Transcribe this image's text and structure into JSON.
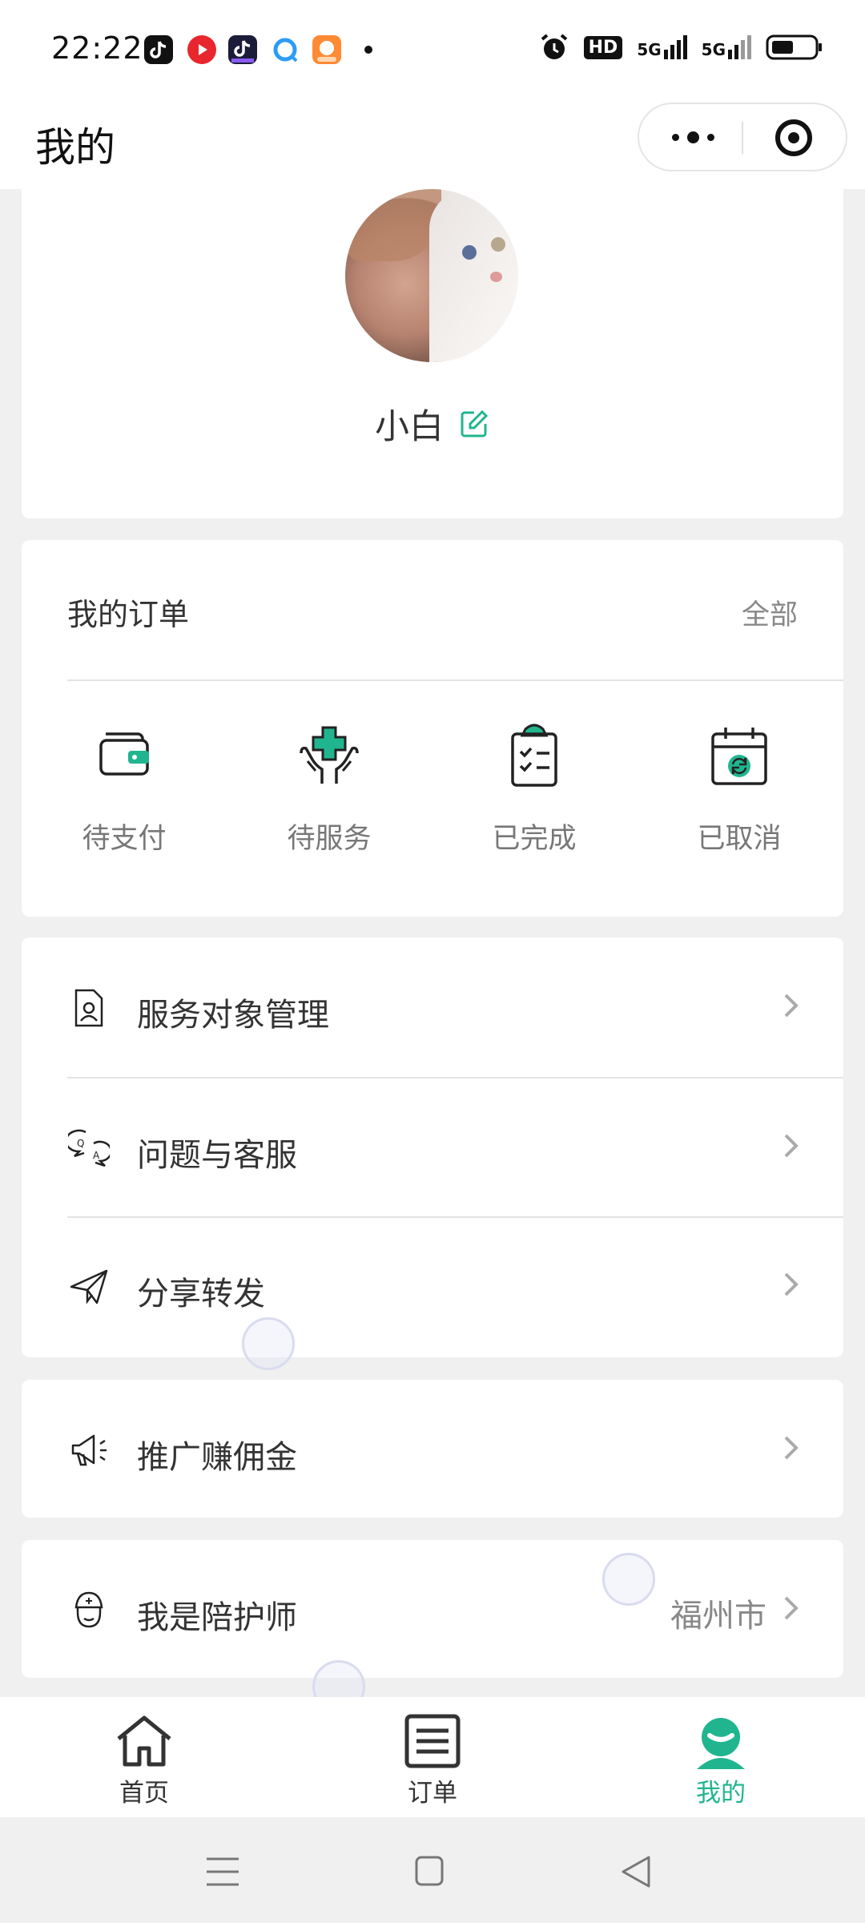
{
  "status_bar": {
    "time": "22:22",
    "app_icons": [
      {
        "icon": "douyin-icon",
        "color": "#111111"
      },
      {
        "icon": "video-app-icon",
        "color": "#e8262d"
      },
      {
        "icon": "douyin-lite-icon",
        "color": "#1b1b3a"
      },
      {
        "icon": "browser-icon",
        "color": "#2c9cf5"
      },
      {
        "icon": "game-app-icon",
        "color": "#ff8a34"
      }
    ],
    "indicators": [
      "alarm-icon",
      "hd-icon",
      "signal-5g-icon",
      "signal-5g-icon",
      "battery-icon"
    ],
    "hd_label": "HD",
    "network_label": "5G"
  },
  "title_bar": {
    "title": "我的"
  },
  "profile": {
    "name": "小白"
  },
  "orders": {
    "title": "我的订单",
    "view_all": "全部",
    "items": [
      {
        "label": "待支付",
        "icon": "wallet-icon"
      },
      {
        "label": "待服务",
        "icon": "medical-care-icon"
      },
      {
        "label": "已完成",
        "icon": "clipboard-check-icon"
      },
      {
        "label": "已取消",
        "icon": "calendar-refresh-icon"
      }
    ]
  },
  "menu": {
    "group1": [
      {
        "label": "服务对象管理",
        "icon": "person-file-icon"
      },
      {
        "label": "问题与客服",
        "icon": "qa-chat-icon"
      },
      {
        "label": "分享转发",
        "icon": "paper-plane-icon"
      }
    ],
    "promote": {
      "label": "推广赚佣金",
      "icon": "megaphone-icon"
    },
    "caregiver": {
      "label": "我是陪护师",
      "value": "福州市",
      "icon": "caregiver-icon"
    }
  },
  "tab_bar": {
    "items": [
      {
        "label": "首页",
        "icon": "home-icon"
      },
      {
        "label": "订单",
        "icon": "list-icon"
      },
      {
        "label": "我的",
        "icon": "profile-icon",
        "active": true
      }
    ]
  },
  "colors": {
    "accent": "#21b58f",
    "background": "#f0f0f0",
    "card": "#ffffff"
  }
}
